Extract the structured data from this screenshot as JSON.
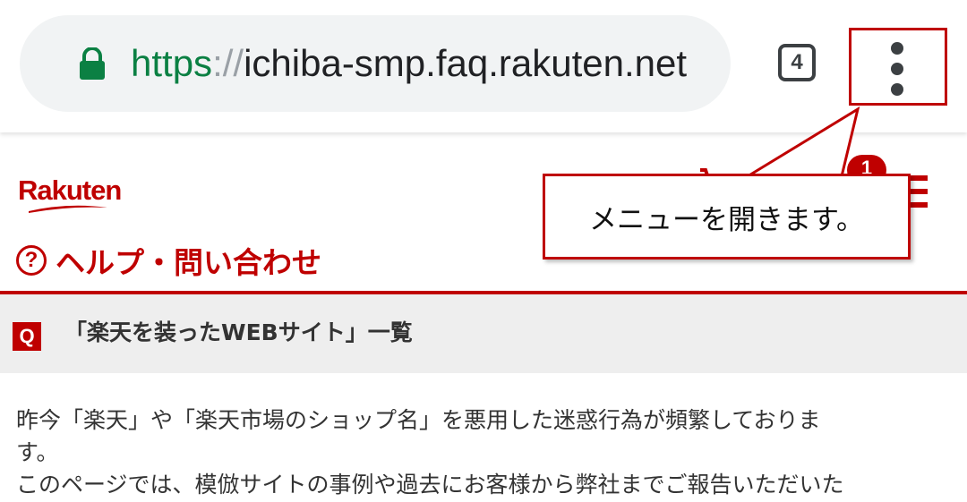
{
  "browser": {
    "url_scheme": "https",
    "url_separator": "://",
    "url_host": "ichiba-smp.faq.rakuten.net",
    "tab_count": "4",
    "lock_icon": "lock-icon",
    "menu_icon": "more-vert-icon"
  },
  "site": {
    "logo_text": "Rakuten",
    "help_title": "ヘルプ・問い合わせ",
    "help_icon_glyph": "?",
    "notification_count": "1",
    "brand_color": "#bf0000"
  },
  "question": {
    "badge": "Q",
    "title": "「楽天を装ったWEBサイト」一覧"
  },
  "content": {
    "paragraph1": "昨今「楽天」や「楽天市場のショップ名」を悪用した迷惑行為が頻繁しておりま",
    "paragraph1_cont": "す。",
    "paragraph2": "このページでは、模倣サイトの事例や過去にお客様から弊社までご報告いただいた"
  },
  "annotation": {
    "callout_text": "メニューを開きます。"
  }
}
